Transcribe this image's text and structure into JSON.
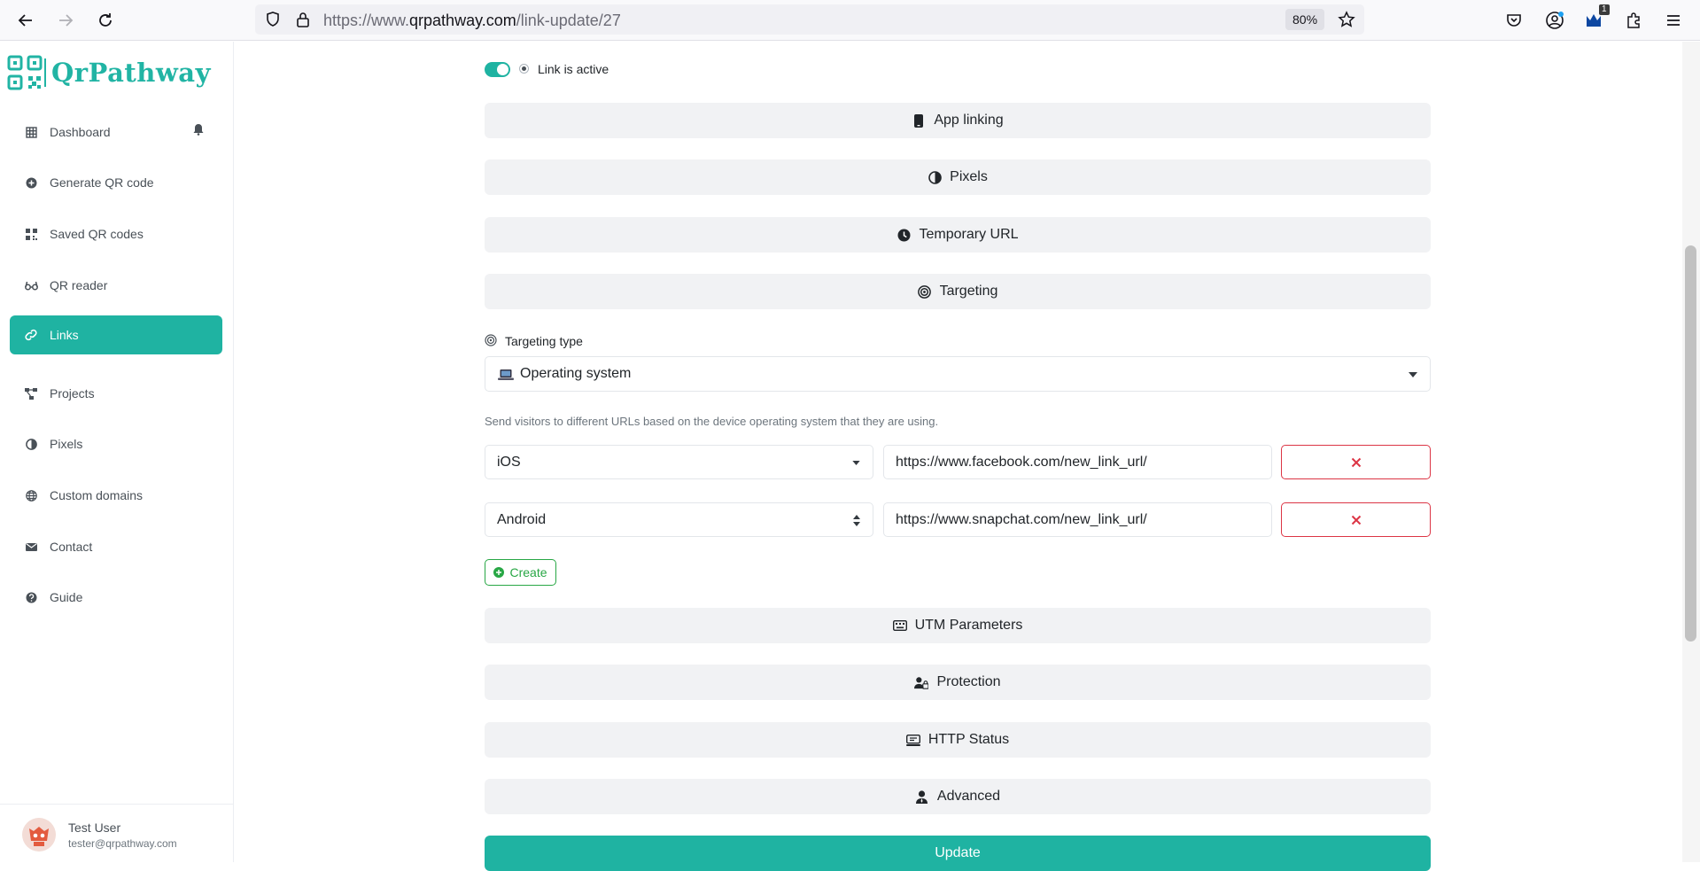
{
  "browser": {
    "url_prefix": "https://www.",
    "url_domain": "qrpathway.com",
    "url_path": "/link-update/27",
    "zoom": "80%",
    "extension_badge": "1"
  },
  "brand": {
    "name": "QrPathway",
    "accent": "#1fb3a2"
  },
  "sidebar": {
    "items": [
      {
        "label": "Dashboard",
        "icon": "grid-icon"
      },
      {
        "label": "Generate QR code",
        "icon": "plus-circle-icon"
      },
      {
        "label": "Saved QR codes",
        "icon": "qrcode-icon"
      },
      {
        "label": "QR reader",
        "icon": "glasses-icon"
      },
      {
        "label": "Links",
        "icon": "link-icon",
        "active": true
      },
      {
        "label": "Projects",
        "icon": "project-diagram-icon"
      },
      {
        "label": "Pixels",
        "icon": "adjust-icon"
      },
      {
        "label": "Custom domains",
        "icon": "globe-icon"
      },
      {
        "label": "Contact",
        "icon": "envelope-icon"
      },
      {
        "label": "Guide",
        "icon": "question-circle-icon"
      }
    ]
  },
  "user": {
    "name": "Test User",
    "email": "tester@qrpathway.com"
  },
  "main": {
    "active_label": "Link is active",
    "sections": {
      "app_linking": "App linking",
      "pixels": "Pixels",
      "temporary_url": "Temporary URL",
      "targeting": "Targeting",
      "utm": "UTM Parameters",
      "protection": "Protection",
      "http_status": "HTTP Status",
      "advanced": "Advanced"
    },
    "targeting": {
      "type_label": "Targeting type",
      "type_value": "Operating system",
      "help": "Send visitors to different URLs based on the device operating system that they are using.",
      "rules": [
        {
          "os": "iOS",
          "url": "https://www.facebook.com/new_link_url/"
        },
        {
          "os": "Android",
          "url": "https://www.snapchat.com/new_link_url/"
        }
      ],
      "create_label": "Create"
    },
    "update_label": "Update"
  }
}
